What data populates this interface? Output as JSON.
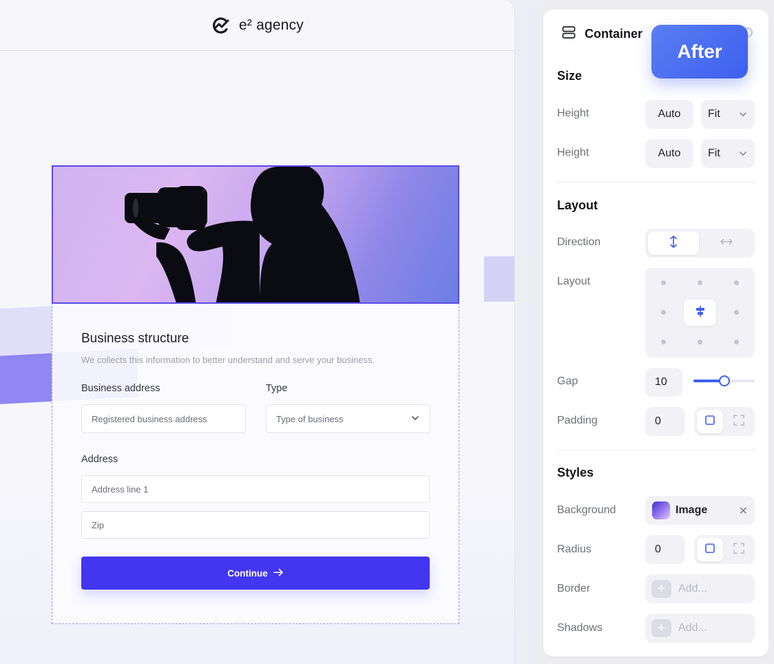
{
  "canvas": {
    "brand": "e² agency",
    "form": {
      "title": "Business structure",
      "subtitle": "We collects this information to better understand and serve your business.",
      "business_address_label": "Business address",
      "business_address_placeholder": "Registered business address",
      "type_label": "Type",
      "type_placeholder": "Type of business",
      "address_label": "Address",
      "address_line1_placeholder": "Address line 1",
      "zip_placeholder": "Zip",
      "continue_label": "Continue"
    }
  },
  "badge": {
    "label": "After"
  },
  "panel": {
    "title": "Container",
    "size": {
      "section": "Size",
      "rows": [
        {
          "label": "Height",
          "value": "Auto",
          "mode": "Fit"
        },
        {
          "label": "Height",
          "value": "Auto",
          "mode": "Fit"
        }
      ]
    },
    "layout": {
      "section": "Layout",
      "direction_label": "Direction",
      "direction_selected": "vertical",
      "layout_label": "Layout",
      "alignment_selected": "center",
      "gap_label": "Gap",
      "gap_value": "10",
      "gap_slider_fraction": 0.5,
      "padding_label": "Padding",
      "padding_value": "0"
    },
    "styles": {
      "section": "Styles",
      "background_label": "Background",
      "background_value": "Image",
      "radius_label": "Radius",
      "radius_value": "0",
      "border_label": "Border",
      "border_placeholder": "Add...",
      "shadows_label": "Shadows",
      "shadows_placeholder": "Add..."
    }
  },
  "colors": {
    "accent": "#4435f0",
    "panel_accent": "#3d5ff0",
    "selection": "#5b4ae6"
  }
}
